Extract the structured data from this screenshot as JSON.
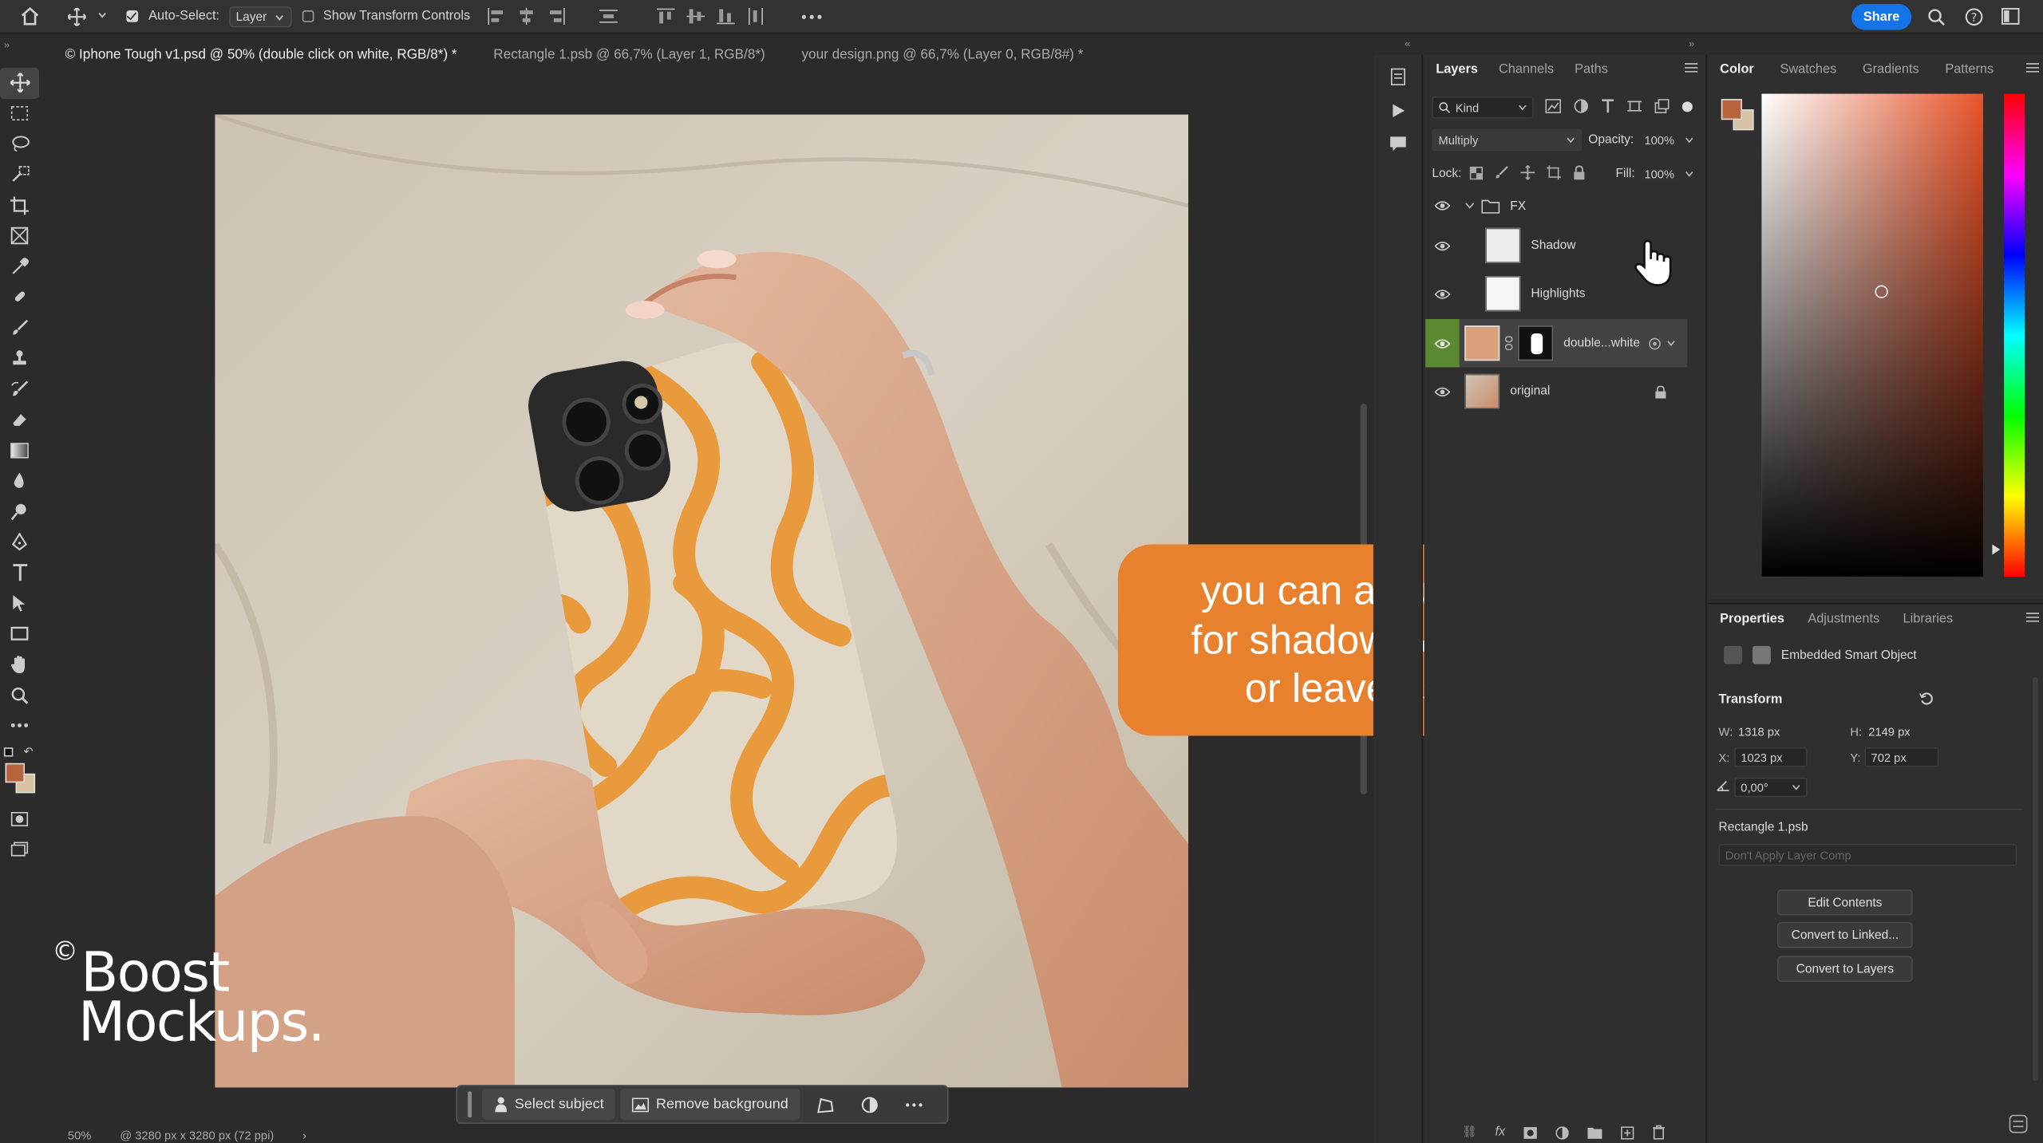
{
  "options_bar": {
    "auto_select_label": "Auto-Select:",
    "auto_select_value": "Layer",
    "show_transform_label": "Show Transform Controls",
    "share_label": "Share"
  },
  "tabs": [
    {
      "label": "© Iphone Tough v1.psd @ 50% (double click on white, RGB/8*) *"
    },
    {
      "label": "Rectangle 1.psb @ 66,7% (Layer 1, RGB/8*)"
    },
    {
      "label": "your design.png @ 66,7% (Layer 0, RGB/8#) *"
    }
  ],
  "layers_panel": {
    "tabs": [
      "Layers",
      "Channels",
      "Paths"
    ],
    "filter_label": "Kind",
    "blend_mode": "Multiply",
    "opacity_label": "Opacity:",
    "opacity_value": "100%",
    "lock_label": "Lock:",
    "fill_label": "Fill:",
    "fill_value": "100%",
    "group_name": "FX",
    "layers": [
      {
        "name": "Shadow"
      },
      {
        "name": "Highlights"
      },
      {
        "name": "double...white"
      },
      {
        "name": "original"
      }
    ]
  },
  "color_panel": {
    "tabs": [
      "Color",
      "Swatches",
      "Gradients",
      "Patterns"
    ],
    "foreground": "#b8633a",
    "background": "#d7c3a4"
  },
  "properties_panel": {
    "tabs": [
      "Properties",
      "Adjustments",
      "Libraries"
    ],
    "object_type": "Embedded Smart Object",
    "transform_label": "Transform",
    "w_label": "W:",
    "w_value": "1318 px",
    "h_label": "H:",
    "h_value": "2149 px",
    "x_label": "X:",
    "x_value": "1023 px",
    "y_label": "Y:",
    "y_value": "702 px",
    "angle_value": "0,00°",
    "linked_file": "Rectangle 1.psb",
    "layer_comp_placeholder": "Don't Apply Layer Comp",
    "buttons": [
      "Edit Contents",
      "Convert to Linked...",
      "Convert to Layers"
    ]
  },
  "context_bar": {
    "select_subject": "Select subject",
    "remove_background": "Remove background"
  },
  "status": {
    "zoom": "50%",
    "doc_info": "3280 px x 3280 px (72 ppi)"
  },
  "callout": {
    "lines": [
      "you can adjust ‘opacity’",
      "for shadows & highlights",
      "or leave as default"
    ]
  },
  "watermark": {
    "symbol": "©",
    "line1": "Boost",
    "line2": "Mockups."
  },
  "colors": {
    "accent": "#1473e6",
    "callout": "#e8812d",
    "case_orange": "#e99a3d"
  }
}
